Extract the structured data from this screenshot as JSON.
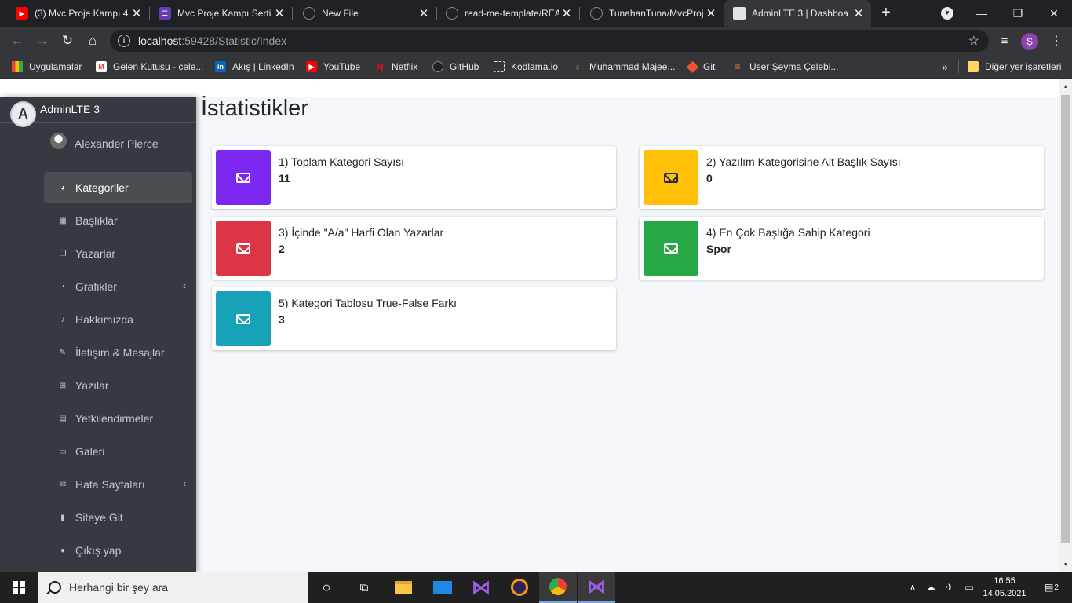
{
  "browser": {
    "tabs": [
      {
        "label": "(3) Mvc Proje Kampı 4(",
        "icon": "youtube-icon"
      },
      {
        "label": "Mvc Proje Kampı Serti",
        "icon": "forms-icon"
      },
      {
        "label": "New File",
        "icon": "github-icon"
      },
      {
        "label": "read-me-template/REA",
        "icon": "github-icon"
      },
      {
        "label": "TunahanTuna/MvcProj",
        "icon": "github-icon"
      },
      {
        "label": "AdminLTE 3 | Dashboa",
        "icon": "page-icon",
        "active": true
      }
    ],
    "url_host": "localhost",
    "url_path": ":59428/Statistic/Index",
    "profile_initial": "Ş",
    "bookmarks": [
      {
        "label": "Uygulamalar",
        "icon": "apps-icon"
      },
      {
        "label": "Gelen Kutusu - cele...",
        "icon": "gmail-icon"
      },
      {
        "label": "Akış | LinkedIn",
        "icon": "linkedin-icon"
      },
      {
        "label": "YouTube",
        "icon": "youtube-icon"
      },
      {
        "label": "Netflix",
        "icon": "netflix-icon"
      },
      {
        "label": "GitHub",
        "icon": "github-icon"
      },
      {
        "label": "Kodlama.io",
        "icon": "kodlama-icon"
      },
      {
        "label": "Muhammad Majee...",
        "icon": "leaf-icon"
      },
      {
        "label": "Git",
        "icon": "git-icon"
      },
      {
        "label": "User Şeyma Çelebi...",
        "icon": "stackoverflow-icon"
      }
    ],
    "other_bookmarks": "Diğer yer işaretleri",
    "overflow": "»"
  },
  "sidebar": {
    "brand": "AdminLTE 3",
    "brand_logo_letter": "A",
    "user": "Alexander Pierce",
    "items": [
      {
        "label": "Kategoriler",
        "icon": "dashboard-icon",
        "active": true
      },
      {
        "label": "Başlıklar",
        "icon": "th-icon"
      },
      {
        "label": "Yazarlar",
        "icon": "copy-icon"
      },
      {
        "label": "Grafikler",
        "icon": "chart-pie-icon",
        "has_children": true
      },
      {
        "label": "Hakkımızda",
        "icon": "bell-icon"
      },
      {
        "label": "İletişim & Mesajlar",
        "icon": "edit-icon"
      },
      {
        "label": "Yazılar",
        "icon": "table-icon"
      },
      {
        "label": "Yetkilendirmeler",
        "icon": "calendar-icon"
      },
      {
        "label": "Galeri",
        "icon": "image-icon"
      },
      {
        "label": "Hata Sayfaları",
        "icon": "envelope-icon",
        "has_children": true
      },
      {
        "label": "Siteye Git",
        "icon": "book-icon"
      },
      {
        "label": "Çıkış yap",
        "icon": "apple-icon"
      }
    ]
  },
  "page": {
    "title": "İstatistikler",
    "boxes": [
      {
        "text": "1) Toplam Kategori Sayısı",
        "value": "11",
        "color": "#7c28f0"
      },
      {
        "text": "2) Yazılım Kategorisine Ait Başlık Sayısı",
        "value": "0",
        "color": "#ffc107"
      },
      {
        "text": "3) İçinde \"A/a\" Harfi Olan Yazarlar",
        "value": "2",
        "color": "#dc3545"
      },
      {
        "text": "4) En Çok Başlığa Sahip Kategori",
        "value": "Spor",
        "color": "#28a745"
      },
      {
        "text": "5) Kategori Tablosu True-False Farkı",
        "value": "3",
        "color": "#17a2b8"
      }
    ]
  },
  "taskbar": {
    "search_placeholder": "Herhangi bir şey ara",
    "time": "16:55",
    "date": "14.05.2021",
    "notification_count": "2"
  }
}
